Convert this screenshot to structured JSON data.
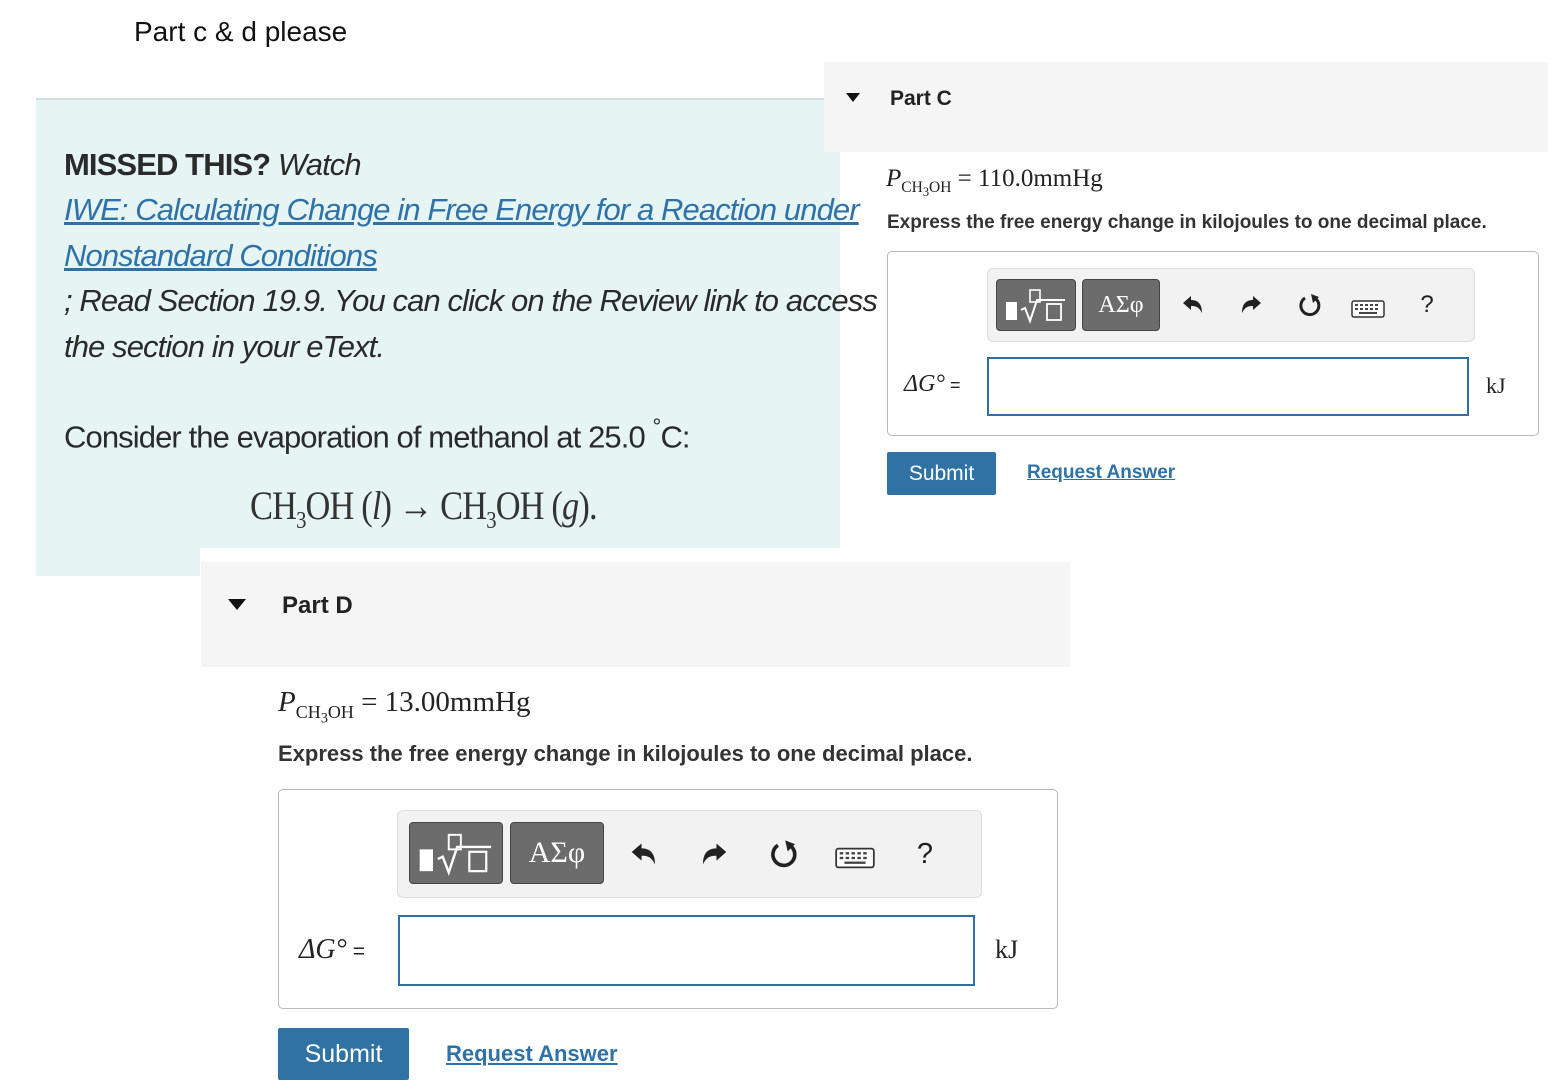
{
  "caption": "Part c & d please",
  "instructions": {
    "missed_bold": "MISSED THIS?",
    "missed_watch": " Watch",
    "link_line1": "IWE: Calculating Change in Free Energy for a Reaction under",
    "link_line2": "Nonstandard Conditions",
    "read_line1": "; Read Section 19.9. You can click on the Review link to access",
    "read_line2": "the section in your eText.",
    "consider_prefix": "Consider the evaporation of methanol at 25.0 ",
    "consider_degree": "°",
    "consider_suffix": "C:",
    "reaction": {
      "left_ch": "CH",
      "left_sub": "3",
      "left_oh": "OH (",
      "left_phase": "l",
      "left_close": ")",
      "arrow": " → ",
      "right_ch": "CH",
      "right_sub": "3",
      "right_oh": "OH (",
      "right_phase": "g",
      "right_close": ")."
    }
  },
  "part_c": {
    "title": "Part C",
    "pressure_p": "P",
    "pressure_sub": "CH",
    "pressure_sub3": "3",
    "pressure_sub_oh": "OH",
    "pressure_value": " = 110.0mmHg",
    "instruction": "Express the free energy change in kilojoules to one decimal place.",
    "symbols_label": "ΑΣφ",
    "help_label": "?",
    "dg_label": "ΔG°",
    "dg_eq": " =",
    "input_value": "",
    "unit": "kJ",
    "submit_label": "Submit",
    "request_label": "Request Answer"
  },
  "part_d": {
    "title": "Part D",
    "pressure_p": "P",
    "pressure_sub": "CH",
    "pressure_sub3": "3",
    "pressure_sub_oh": "OH",
    "pressure_value": " = 13.00mmHg",
    "instruction": "Express the free energy change in kilojoules to one decimal place.",
    "symbols_label": "ΑΣφ",
    "help_label": "?",
    "dg_label": "ΔG°",
    "dg_eq": " =",
    "input_value": "",
    "unit": "kJ",
    "submit_label": "Submit",
    "request_label": "Request Answer"
  },
  "icons": {
    "collapse": "triangle-down-icon",
    "templates": "sqrt-template-icon",
    "undo": "undo-icon",
    "redo": "redo-icon",
    "reset": "reset-icon",
    "keyboard": "keyboard-icon",
    "help": "help-icon"
  },
  "colors": {
    "panel_bg": "#e6f4f4",
    "link": "#2e72a8",
    "submit_bg": "#2f72a3",
    "input_border": "#2f6fa3",
    "toolbar_button": "#6c6c6c"
  }
}
